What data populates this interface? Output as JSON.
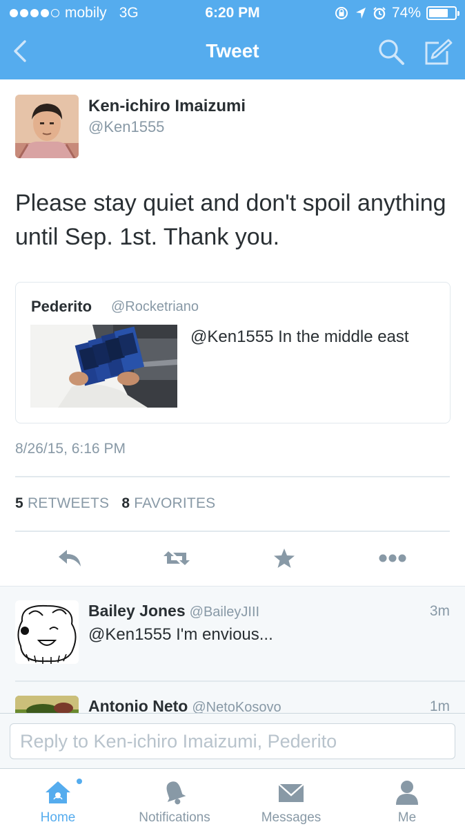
{
  "status_bar": {
    "carrier": "mobily",
    "network": "3G",
    "time": "6:20 PM",
    "battery": "74%",
    "battery_level": 0.74,
    "signal_bars_filled": 4,
    "signal_bars_total": 5
  },
  "nav": {
    "title": "Tweet",
    "back_icon": "chevron-left-icon",
    "search_icon": "search-icon",
    "compose_icon": "compose-icon"
  },
  "tweet": {
    "author_name": "Ken-ichiro Imaizumi",
    "author_handle": "@Ken1555",
    "text": "Please stay quiet and don't spoil anything until Sep. 1st. Thank you.",
    "quoted": {
      "name": "Pederito",
      "handle": "@Rocketriano",
      "text": "@Ken1555 In the middle east"
    },
    "timestamp": "8/26/15, 6:16 PM",
    "retweets_count": "5",
    "retweets_label": "RETWEETS",
    "favorites_count": "8",
    "favorites_label": "FAVORITES"
  },
  "actions": [
    "reply-icon",
    "retweet-icon",
    "favorite-icon",
    "more-icon"
  ],
  "replies": [
    {
      "name": "Bailey Jones",
      "handle": "@BaileyJIII",
      "time": "3m",
      "text": "@Ken1555 I'm envious..."
    },
    {
      "name": "Antonio Neto",
      "handle": "@NetoKosovo",
      "time": "1m",
      "text": ""
    }
  ],
  "reply_bar": {
    "placeholder": "Reply to Ken-ichiro Imaizumi, Pederito"
  },
  "tabs": [
    {
      "label": "Home",
      "icon": "home-icon",
      "active": true
    },
    {
      "label": "Notifications",
      "icon": "bell-icon",
      "active": false
    },
    {
      "label": "Messages",
      "icon": "envelope-icon",
      "active": false
    },
    {
      "label": "Me",
      "icon": "person-icon",
      "active": false
    }
  ],
  "colors": {
    "accent": "#55acee",
    "text": "#292f33",
    "muted": "#8899a6",
    "border": "#e1e8ed"
  }
}
